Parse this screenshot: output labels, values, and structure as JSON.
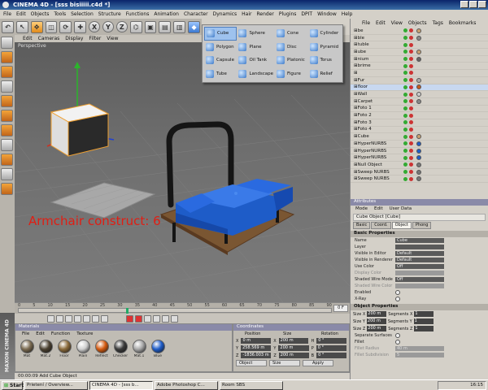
{
  "window": {
    "title": "CINEMA 4D - [sss bisiiiii.c4d *]"
  },
  "menu": [
    "File",
    "Edit",
    "Objects",
    "Tools",
    "Selection",
    "Structure",
    "Functions",
    "Animation",
    "Character",
    "Dynamics",
    "Hair",
    "Render",
    "Plugins",
    "DPIT",
    "Window",
    "Help"
  ],
  "toolbar": {
    "x": "X",
    "y": "Y",
    "z": "Z"
  },
  "viewport": {
    "menu": [
      "Edit",
      "Cameras",
      "Display",
      "Filter",
      "View"
    ],
    "label": "Perspective",
    "overlay": "Armchair construct: 6"
  },
  "timeline": {
    "ticks": [
      "0",
      "5",
      "10",
      "15",
      "20",
      "25",
      "30",
      "35",
      "40",
      "45",
      "50",
      "55",
      "60",
      "65",
      "70",
      "75",
      "80",
      "85",
      "90"
    ],
    "end_frame": "0 F",
    "marker_frame": 31
  },
  "materials": {
    "header": "Materials",
    "menu": [
      "File",
      "Edit",
      "Function",
      "Texture"
    ],
    "items": [
      {
        "name": "Mat",
        "color": "#7a6a50"
      },
      {
        "name": "Mat.2",
        "color": "#4a4030"
      },
      {
        "name": "Floor",
        "color": "#8a6a3a"
      },
      {
        "name": "Plain",
        "color": "#cfcfcf"
      },
      {
        "name": "Reflect",
        "color": "#d45a10"
      },
      {
        "name": "Checker",
        "color": "#3a3a3a"
      },
      {
        "name": "Mat.1",
        "color": "#a8a8a8"
      },
      {
        "name": "Blue",
        "color": "#1e5cc8"
      }
    ]
  },
  "coordinates": {
    "header": "Coordinates",
    "cols": [
      "Position",
      "Size",
      "Rotation"
    ],
    "rows": [
      {
        "axis": "X",
        "pos": "0 m",
        "size": "200 m",
        "rot_label": "H",
        "rot": "0 °"
      },
      {
        "axis": "Y",
        "pos": "258.569 m",
        "size": "200 m",
        "rot_label": "P",
        "rot": "0 °"
      },
      {
        "axis": "Z",
        "pos": "-1836.003 m",
        "size": "200 m",
        "rot_label": "B",
        "rot": "0 °"
      }
    ],
    "mode1": "Object",
    "mode2": "Size",
    "apply": "Apply"
  },
  "status": {
    "text": "00:00:09   Add Cube Object"
  },
  "logo": {
    "text": "MAXON CINEMA 4D"
  },
  "objects": {
    "menu": [
      "File",
      "Edit",
      "View",
      "Objects",
      "Tags",
      "Bookmarks"
    ],
    "items": [
      {
        "name": "be",
        "tag": "#c9a070"
      },
      {
        "name": "ble",
        "tag": "#888"
      },
      {
        "name": "tuble",
        "tag": ""
      },
      {
        "name": "ube",
        "tag": "#c9a070"
      },
      {
        "name": "nium",
        "tag": "#666"
      },
      {
        "name": "brime",
        "tag": ""
      },
      {
        "name": "",
        "tag": ""
      },
      {
        "name": "Fur",
        "tag": "#aaa"
      },
      {
        "name": "floor",
        "tag": "#c85a1e"
      },
      {
        "name": "Wall",
        "tag": "#ccc"
      },
      {
        "name": "Carpet",
        "tag": "#888"
      },
      {
        "name": "Foto 1",
        "tag": ""
      },
      {
        "name": "Foto 2",
        "tag": ""
      },
      {
        "name": "Foto 3",
        "tag": ""
      },
      {
        "name": "Foto 4",
        "tag": ""
      },
      {
        "name": "Cube",
        "tag": "#c9a070"
      },
      {
        "name": "HyperNURBS",
        "tag": "#1e5cc8"
      },
      {
        "name": "HyperNURBS",
        "tag": "#1e5cc8"
      },
      {
        "name": "HyperNURBS",
        "tag": "#1e5cc8"
      },
      {
        "name": "Null Object",
        "tag": "#777"
      },
      {
        "name": "Sweep NURBS",
        "tag": "#777"
      },
      {
        "name": "Sweep NURBS",
        "tag": "#777"
      }
    ]
  },
  "attributes": {
    "header": "Attributes",
    "menu": [
      "Mode",
      "Edit",
      "User Data"
    ],
    "title": "Cube Object [Cube]",
    "tabs": [
      "Basic",
      "Coord.",
      "Object",
      "Phong"
    ],
    "basic_header": "Basic Properties",
    "basic": [
      {
        "label": "Name",
        "value": "Cube",
        "dim": false
      },
      {
        "label": "Layer",
        "value": "",
        "dim": false
      },
      {
        "label": "Visible in Editor",
        "value": "Default",
        "dim": false
      },
      {
        "label": "Visible in Renderer",
        "value": "Default",
        "dim": false
      },
      {
        "label": "Use Color",
        "value": "Off",
        "dim": false
      },
      {
        "label": "Display Color",
        "value": "",
        "dim": true
      },
      {
        "label": "Shaded Wire Mode",
        "value": "Off",
        "dim": false
      },
      {
        "label": "Shaded Wire Color",
        "value": "",
        "dim": true
      },
      {
        "label": "Enabled",
        "value": "",
        "dim": false
      },
      {
        "label": "X-Ray",
        "value": "",
        "dim": false
      }
    ],
    "object_header": "Object Properties",
    "sizes": [
      {
        "label": "Size X",
        "value": "200 m",
        "seg": "Segments X",
        "segval": "1"
      },
      {
        "label": "Size Y",
        "value": "200 m",
        "seg": "Segments Y",
        "segval": "1"
      },
      {
        "label": "Size Z",
        "value": "200 m",
        "seg": "Segments Z",
        "segval": "1"
      }
    ],
    "extra": [
      {
        "label": "Separate Surfaces",
        "dim": false
      },
      {
        "label": "Fillet",
        "dim": false
      },
      {
        "label": "Fillet Radius",
        "value": "40 m",
        "dim": true
      },
      {
        "label": "Fillet Subdivision",
        "value": "5",
        "dim": true
      }
    ]
  },
  "popup": {
    "items": [
      [
        "Cube",
        "Sphere",
        "Cone",
        "Cylinder"
      ],
      [
        "Polygon",
        "Plane",
        "Disc",
        "Pyramid"
      ],
      [
        "Capsule",
        "Oil Tank",
        "Platonic",
        "Torus"
      ],
      [
        "Tube",
        "Landscape",
        "Figure",
        "Relief"
      ]
    ]
  },
  "taskbar": {
    "start": "Start",
    "tasks": [
      "Prietení / Overview...",
      "CINEMA 4D - [sss b...",
      "Adobe Photoshop C...",
      "Room SBS"
    ],
    "clock": "16:15"
  },
  "colors": {
    "accent": "#0a246a",
    "overlay": "#e01e14",
    "chair_blue": "#1e5cc8"
  }
}
